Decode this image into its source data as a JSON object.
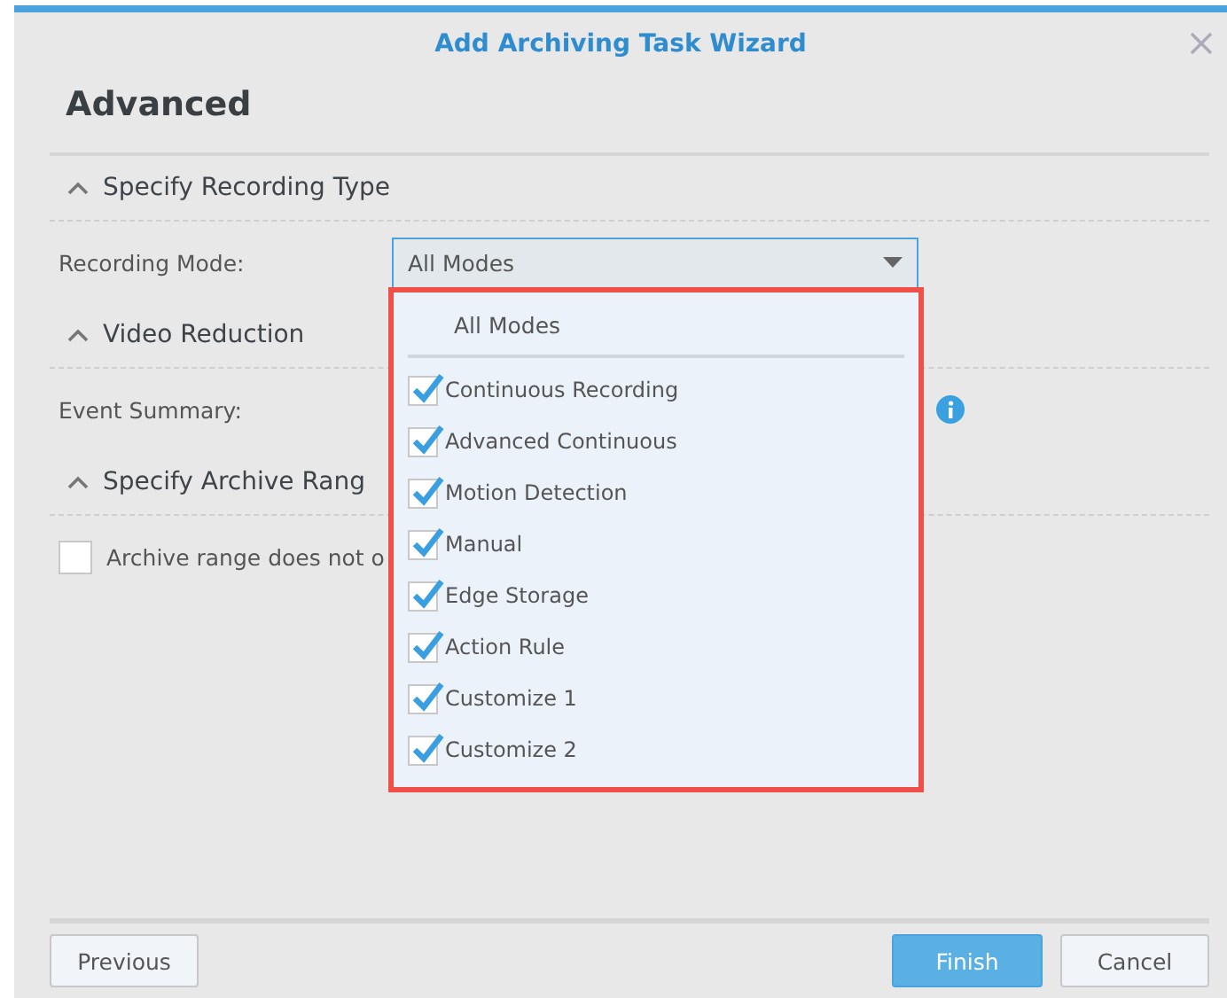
{
  "dialog": {
    "title": "Add Archiving Task Wizard",
    "heading": "Advanced"
  },
  "sections": [
    {
      "title": "Specify Recording Type",
      "expanded": true
    },
    {
      "title": "Video Reduction",
      "expanded": true
    },
    {
      "title": "Specify Archive Rang",
      "expanded": true
    }
  ],
  "recording_mode": {
    "label": "Recording Mode:",
    "value": "All Modes"
  },
  "event_summary": {
    "label": "Event Summary:"
  },
  "archive_range": {
    "label": "Archive range does not o",
    "checked": false
  },
  "dropdown": {
    "header": "All Modes",
    "options": [
      {
        "label": "Continuous Recording",
        "checked": true
      },
      {
        "label": "Advanced Continuous",
        "checked": true
      },
      {
        "label": "Motion Detection",
        "checked": true
      },
      {
        "label": "Manual",
        "checked": true
      },
      {
        "label": "Edge Storage",
        "checked": true
      },
      {
        "label": "Action Rule",
        "checked": true
      },
      {
        "label": "Customize 1",
        "checked": true
      },
      {
        "label": "Customize 2",
        "checked": true
      }
    ]
  },
  "buttons": [
    {
      "label": "Previous",
      "kind": "secondary"
    },
    {
      "label": "Finish",
      "kind": "primary"
    },
    {
      "label": "Cancel",
      "kind": "secondary"
    }
  ]
}
